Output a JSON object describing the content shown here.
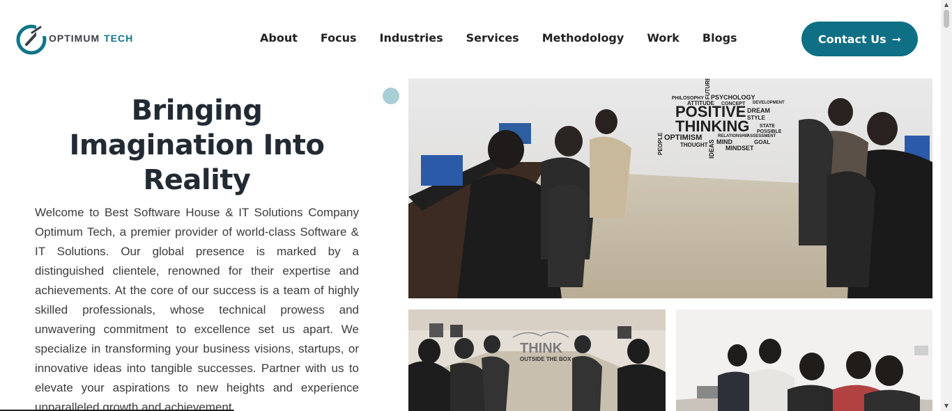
{
  "logo": {
    "text_1": "OPTIMUM",
    "text_2": "TECH",
    "icon": "optimum-tech-logo-mark"
  },
  "nav": {
    "items": [
      {
        "label": "About"
      },
      {
        "label": "Focus"
      },
      {
        "label": "Industries"
      },
      {
        "label": "Services"
      },
      {
        "label": "Methodology"
      },
      {
        "label": "Work"
      },
      {
        "label": "Blogs"
      }
    ]
  },
  "contact": {
    "label": "Contact Us",
    "icon": "arrow-right-icon",
    "arrow": "➞"
  },
  "hero": {
    "title": "Bringing Imagination Into Reality",
    "body": "Welcome to Best Software House & IT Solutions Company Optimum Tech, a premier provider of world-class Software & IT Solutions. Our global presence is marked by a distinguished clientele, renowned for their expertise and achievements. At the core of our success is a team of highly skilled professionals, whose technical prowess and unwavering commitment to excellence set us apart. We specialize in transforming your business visions, startups, or innovative ideas into tangible successes. Partner with us to elevate your aspirations to new heights and experience unparalleled growth and achievement."
  },
  "images": {
    "main": {
      "wall_words_big": [
        "POSITIVE",
        "THINKING"
      ],
      "wall_words_small": [
        "PSYCHOLOGY",
        "PHILOSOPHY",
        "ATTITUDE",
        "CONCEPT",
        "DEVELOPMENT",
        "DREAM",
        "STYLE",
        "STATE",
        "POSSIBLE",
        "OPTIMISM",
        "THOUGHT",
        "MIND",
        "GOAL",
        "MINDSET",
        "IDEAS",
        "PEOPLE",
        "FUTURE",
        "RELATIONSHIP",
        "ASSESSMENT"
      ]
    },
    "bottom_left": {
      "sign_1": "THINK",
      "sign_2": "OUTSIDE THE BOX"
    },
    "bottom_right": {}
  },
  "colors": {
    "brand": "#0f6f85",
    "accent_dot": "#a8cfd6",
    "heading": "#222a33"
  }
}
